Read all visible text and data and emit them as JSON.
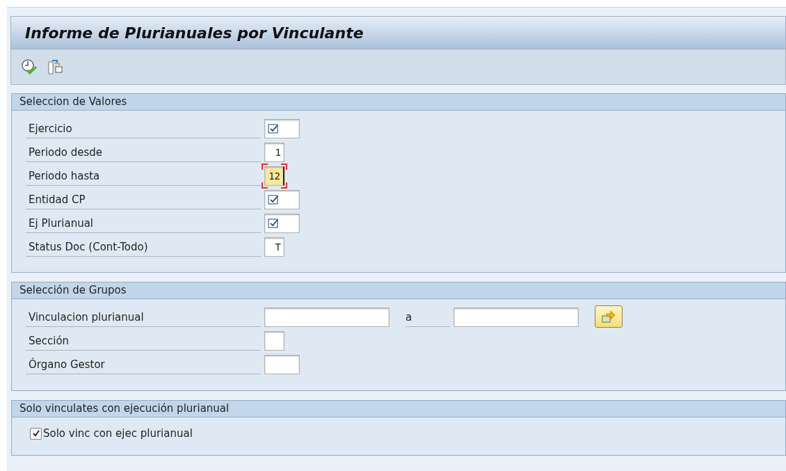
{
  "window": {
    "title": "Informe de Plurianuales por Vinculante"
  },
  "groups": [
    {
      "title": "Seleccion de Valores",
      "rows": [
        {
          "label": "Ejercicio",
          "fields": [
            {
              "kind": "required",
              "focused": false
            }
          ]
        },
        {
          "label": "Periodo desde",
          "fields": [
            {
              "kind": "short",
              "value": "1",
              "focused": false
            }
          ]
        },
        {
          "label": "Periodo hasta",
          "fields": [
            {
              "kind": "short",
              "value": "12",
              "focused": true
            }
          ]
        },
        {
          "label": "Entidad CP",
          "fields": [
            {
              "kind": "required",
              "focused": false
            }
          ]
        },
        {
          "label": "Ej Plurianual",
          "fields": [
            {
              "kind": "required",
              "focused": false
            }
          ]
        },
        {
          "label": "Status Doc (Cont-Todo)",
          "fields": [
            {
              "kind": "short",
              "value": "T",
              "focused": false
            }
          ]
        }
      ]
    },
    {
      "title": "Selección de Grupos",
      "rows": [
        {
          "label": "Vinculacion plurianual",
          "fields": [
            {
              "kind": "long",
              "focused": false
            }
          ],
          "to_label": "a",
          "to_fields": [
            {
              "kind": "long",
              "focused": false
            }
          ],
          "multiple_selection": true
        },
        {
          "label": "Sección",
          "fields": [
            {
              "kind": "short",
              "focused": false
            }
          ]
        },
        {
          "label": "Órgano Gestor",
          "fields": [
            {
              "kind": "medium",
              "focused": false
            }
          ]
        }
      ]
    },
    {
      "title": "Solo vinculates con ejecución plurianual",
      "checkboxes": [
        {
          "label": "Solo vinc con ejec plurianual",
          "checked": true
        }
      ]
    }
  ]
}
